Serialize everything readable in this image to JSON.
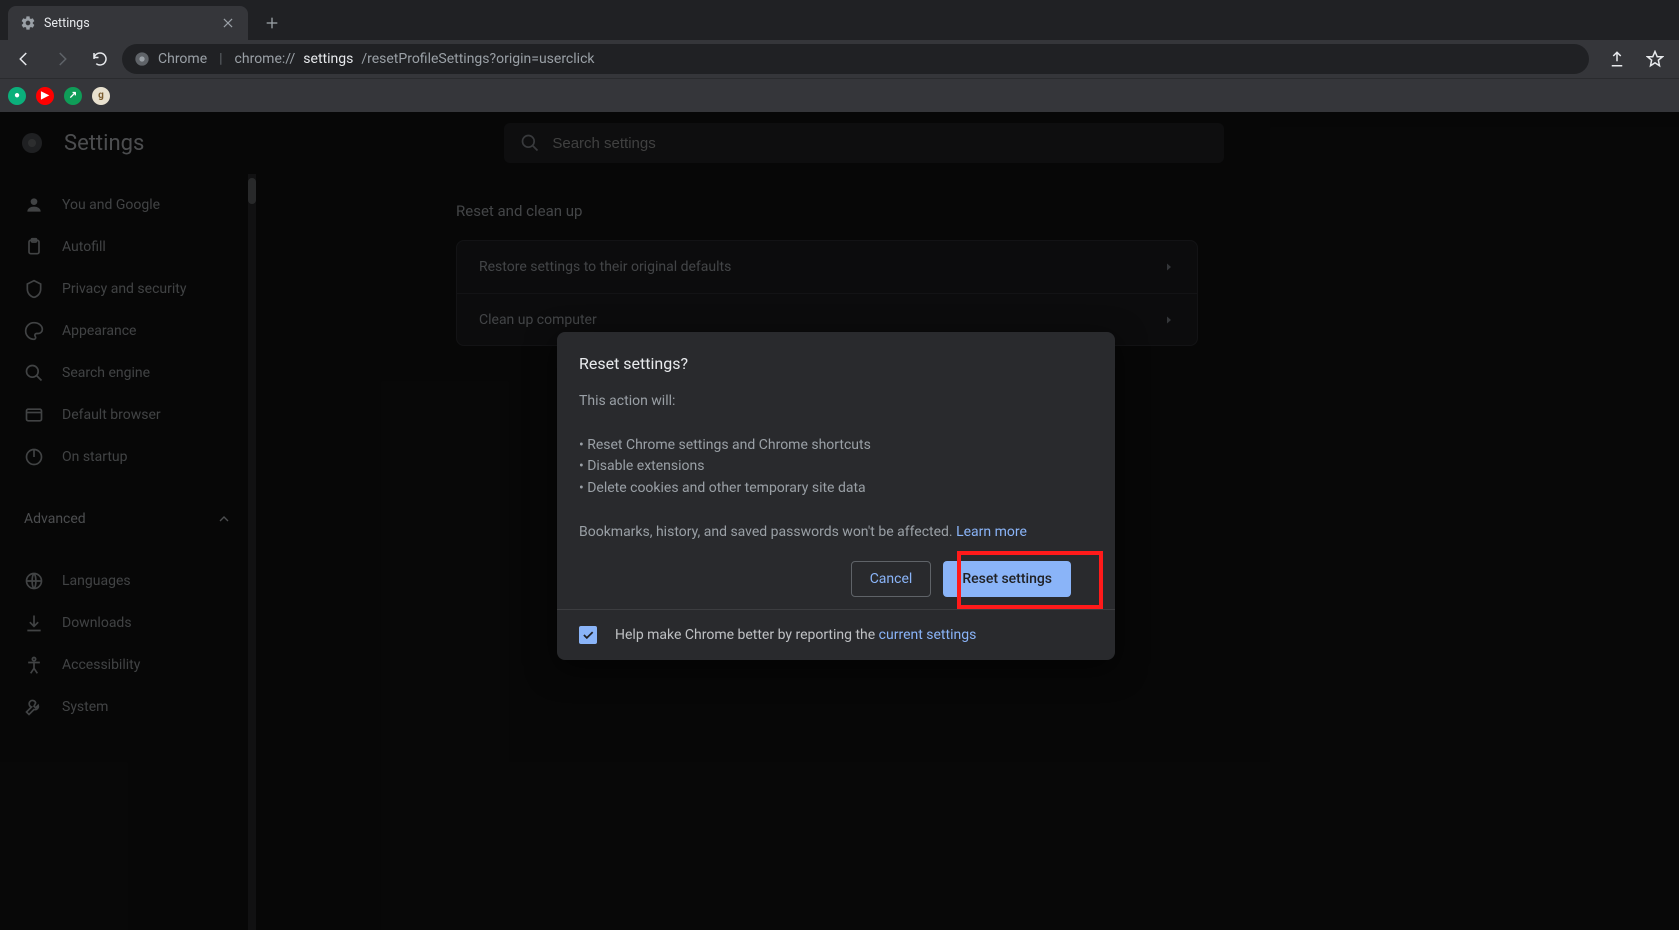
{
  "browser": {
    "tab_title": "Settings",
    "url_prefix": "Chrome",
    "url_scheme": "chrome://",
    "url_path_strong": "settings",
    "url_path_rest": "/resetProfileSettings?origin=userclick"
  },
  "bookmarks": [
    "cb",
    "yt",
    "dv",
    "g"
  ],
  "header": {
    "title": "Settings",
    "search_placeholder": "Search settings"
  },
  "sidebar": {
    "items": [
      {
        "label": "You and Google"
      },
      {
        "label": "Autofill"
      },
      {
        "label": "Privacy and security"
      },
      {
        "label": "Appearance"
      },
      {
        "label": "Search engine"
      },
      {
        "label": "Default browser"
      },
      {
        "label": "On startup"
      }
    ],
    "advanced_label": "Advanced",
    "items2": [
      {
        "label": "Languages"
      },
      {
        "label": "Downloads"
      },
      {
        "label": "Accessibility"
      },
      {
        "label": "System"
      }
    ]
  },
  "main": {
    "section_title": "Reset and clean up",
    "rows": [
      {
        "label": "Restore settings to their original defaults"
      },
      {
        "label": "Clean up computer"
      }
    ]
  },
  "dialog": {
    "title": "Reset settings?",
    "lead": "This action will:",
    "bullets": [
      "Reset Chrome settings and Chrome shortcuts",
      "Disable extensions",
      "Delete cookies and other temporary site data"
    ],
    "footnote_prefix": "Bookmarks, history, and saved passwords won't be affected. ",
    "learn_more": "Learn more",
    "cancel": "Cancel",
    "confirm": "Reset settings",
    "help_prefix": "Help make Chrome better by reporting the ",
    "help_link": "current settings",
    "checked": true
  }
}
